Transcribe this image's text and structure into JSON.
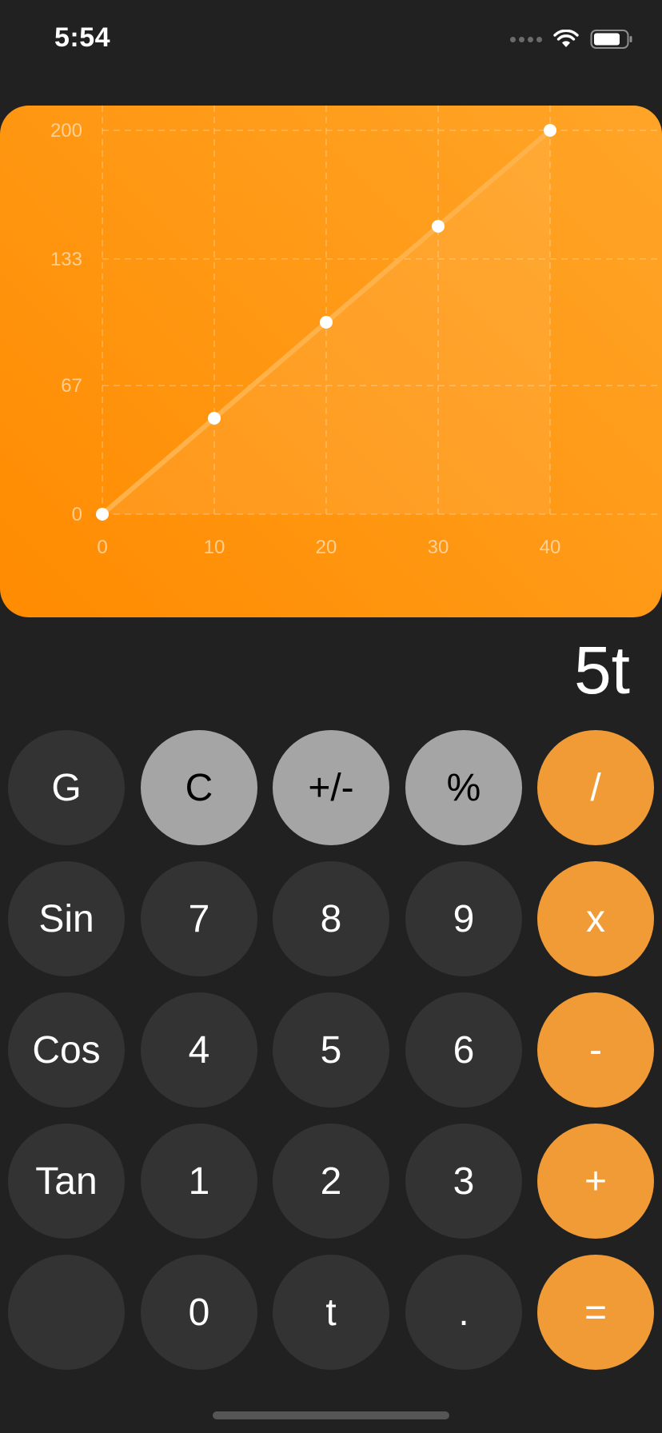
{
  "status": {
    "time": "5:54"
  },
  "chart_data": {
    "type": "line",
    "title": "",
    "xlabel": "",
    "ylabel": "",
    "x": [
      0,
      10,
      20,
      30,
      40
    ],
    "series": [
      {
        "values": [
          0,
          50,
          100,
          150,
          200
        ]
      }
    ],
    "xlim": [
      0,
      40
    ],
    "ylim": [
      0,
      200
    ],
    "x_ticks": [
      "0",
      "10",
      "20",
      "30",
      "40"
    ],
    "y_ticks": [
      "0",
      "67",
      "133",
      "200"
    ],
    "y_tick_values": [
      0,
      67,
      133,
      200
    ],
    "grid": true,
    "grid_style": "dashed",
    "line_color": "#ffb24a",
    "point_color": "#ffffff"
  },
  "display": {
    "expression": "5t"
  },
  "colors": {
    "accent": "#f09b36",
    "key_dark": "#333333",
    "key_light": "#a5a5a5",
    "background": "#212121"
  },
  "keypad": {
    "rows": [
      [
        {
          "label": "G",
          "style": "dark",
          "name": "graph"
        },
        {
          "label": "C",
          "style": "light",
          "name": "clear"
        },
        {
          "label": "+/-",
          "style": "light",
          "name": "sign"
        },
        {
          "label": "%",
          "style": "light",
          "name": "percent"
        },
        {
          "label": "/",
          "style": "op",
          "name": "divide"
        }
      ],
      [
        {
          "label": "Sin",
          "style": "dark",
          "name": "sin"
        },
        {
          "label": "7",
          "style": "dark",
          "name": "7"
        },
        {
          "label": "8",
          "style": "dark",
          "name": "8"
        },
        {
          "label": "9",
          "style": "dark",
          "name": "9"
        },
        {
          "label": "x",
          "style": "op",
          "name": "multiply"
        }
      ],
      [
        {
          "label": "Cos",
          "style": "dark",
          "name": "cos"
        },
        {
          "label": "4",
          "style": "dark",
          "name": "4"
        },
        {
          "label": "5",
          "style": "dark",
          "name": "5"
        },
        {
          "label": "6",
          "style": "dark",
          "name": "6"
        },
        {
          "label": "-",
          "style": "op",
          "name": "subtract"
        }
      ],
      [
        {
          "label": "Tan",
          "style": "dark",
          "name": "tan"
        },
        {
          "label": "1",
          "style": "dark",
          "name": "1"
        },
        {
          "label": "2",
          "style": "dark",
          "name": "2"
        },
        {
          "label": "3",
          "style": "dark",
          "name": "3"
        },
        {
          "label": "+",
          "style": "op",
          "name": "add"
        }
      ],
      [
        {
          "label": "",
          "style": "dark",
          "name": "blank"
        },
        {
          "label": "0",
          "style": "dark",
          "name": "0"
        },
        {
          "label": "t",
          "style": "dark",
          "name": "t"
        },
        {
          "label": ".",
          "style": "dark",
          "name": "decimal"
        },
        {
          "label": "=",
          "style": "op",
          "name": "equals"
        }
      ]
    ]
  }
}
